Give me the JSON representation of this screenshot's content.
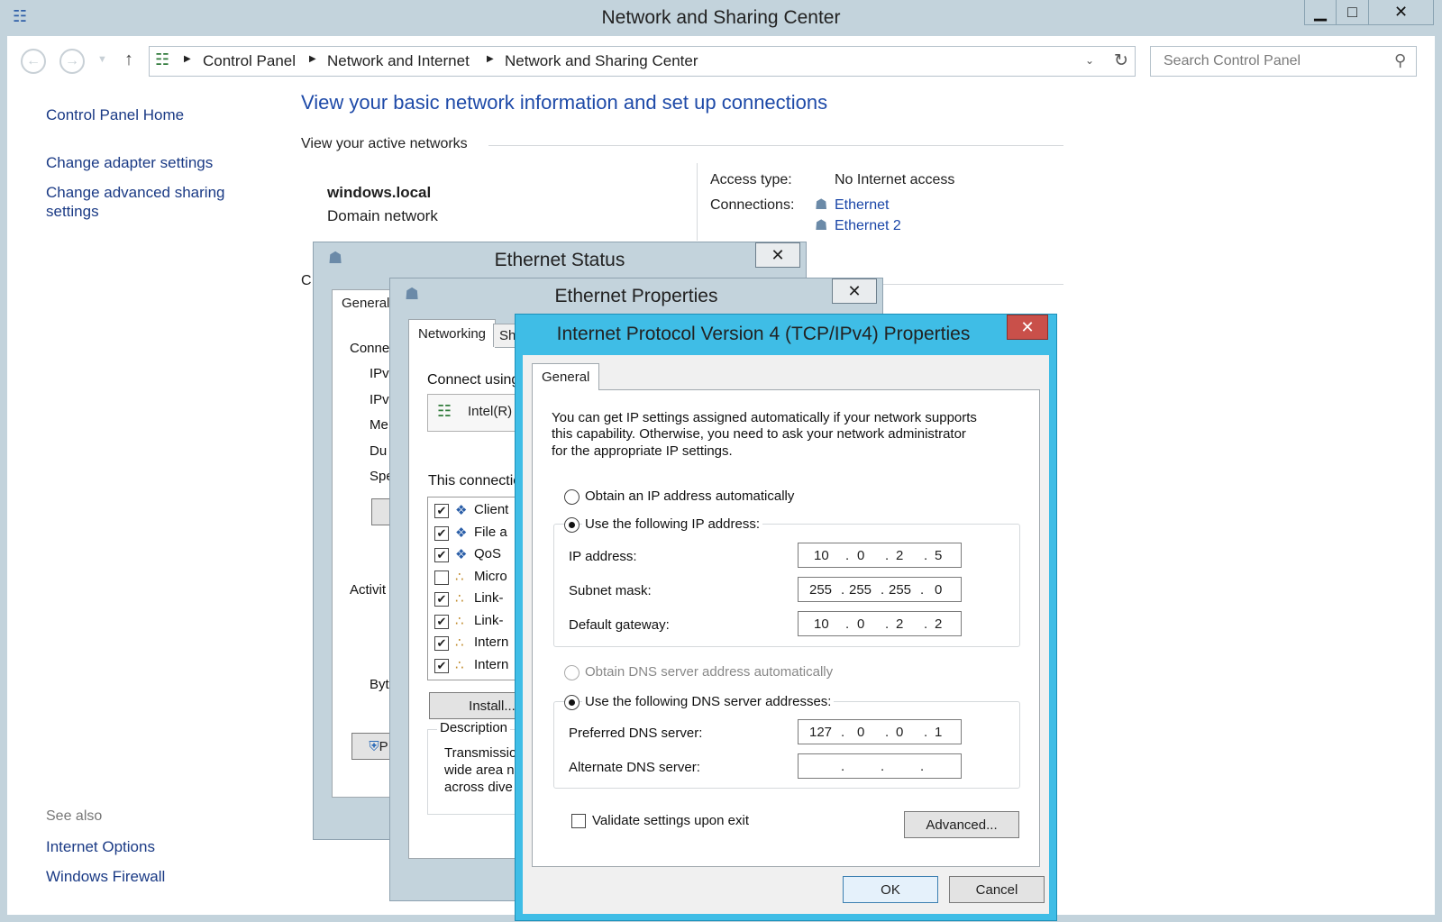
{
  "window": {
    "title": "Network and Sharing Center",
    "min": "▁",
    "max": "□",
    "close": "✕"
  },
  "address": {
    "crumbs": [
      "Control Panel",
      "Network and Internet",
      "Network and Sharing Center"
    ],
    "search_placeholder": "Search Control Panel"
  },
  "sidebar": {
    "home": "Control Panel Home",
    "items": [
      "Change adapter settings",
      "Change advanced sharing",
      "settings"
    ],
    "see_also": "See also",
    "see_also_items": [
      "Internet Options",
      "Windows Firewall"
    ]
  },
  "main": {
    "heading": "View your basic network information and set up connections",
    "active_networks": "View your active networks",
    "network_name": "windows.local",
    "network_type": "Domain network",
    "access_type_label": "Access type:",
    "access_type_value": "No Internet access",
    "connections_label": "Connections:",
    "connections": [
      "Ethernet",
      "Ethernet 2"
    ],
    "partial_c": "C"
  },
  "eth_status": {
    "title": "Ethernet Status",
    "tab": "General",
    "rows": [
      "Conne",
      "IPv",
      "IPv",
      "Me",
      "Du",
      "Spe"
    ],
    "activity": "Activit",
    "bytes": "Byt",
    "props_partial": "P"
  },
  "eth_props": {
    "title": "Ethernet Properties",
    "tab_networking": "Networking",
    "tab_sharing": "Sh",
    "connect_using": "Connect using",
    "adapter": "Intel(R)",
    "this_connection": "This connectio",
    "items": [
      {
        "label": "Client",
        "checked": true
      },
      {
        "label": "File a",
        "checked": true
      },
      {
        "label": "QoS",
        "checked": true
      },
      {
        "label": "Micro",
        "checked": false
      },
      {
        "label": "Link-",
        "checked": true
      },
      {
        "label": "Link-",
        "checked": true
      },
      {
        "label": "Intern",
        "checked": true
      },
      {
        "label": "Intern",
        "checked": true
      }
    ],
    "install": "Install...",
    "description": "Description",
    "desc_lines": [
      "Transmissio",
      "wide area n",
      "across dive"
    ]
  },
  "ipv4": {
    "title": "Internet Protocol Version 4 (TCP/IPv4) Properties",
    "close": "✕",
    "tab": "General",
    "intro": [
      "You can get IP settings assigned automatically if your network supports",
      "this capability. Otherwise, you need to ask your network administrator",
      "for the appropriate IP settings."
    ],
    "obtain_ip_auto": "Obtain an IP address automatically",
    "use_following_ip": "Use the following IP address:",
    "ip_label": "IP address:",
    "ip": [
      "10",
      "0",
      "2",
      "5"
    ],
    "mask_label": "Subnet mask:",
    "mask": [
      "255",
      "255",
      "255",
      "0"
    ],
    "gw_label": "Default gateway:",
    "gw": [
      "10",
      "0",
      "2",
      "2"
    ],
    "obtain_dns_auto": "Obtain DNS server address automatically",
    "use_following_dns": "Use the following DNS server addresses:",
    "pref_dns_label": "Preferred DNS server:",
    "pref_dns": [
      "127",
      "0",
      "0",
      "1"
    ],
    "alt_dns_label": "Alternate DNS server:",
    "alt_dns": [
      "",
      "",
      "",
      ""
    ],
    "validate": "Validate settings upon exit",
    "advanced": "Advanced...",
    "ok": "OK",
    "cancel": "Cancel"
  }
}
